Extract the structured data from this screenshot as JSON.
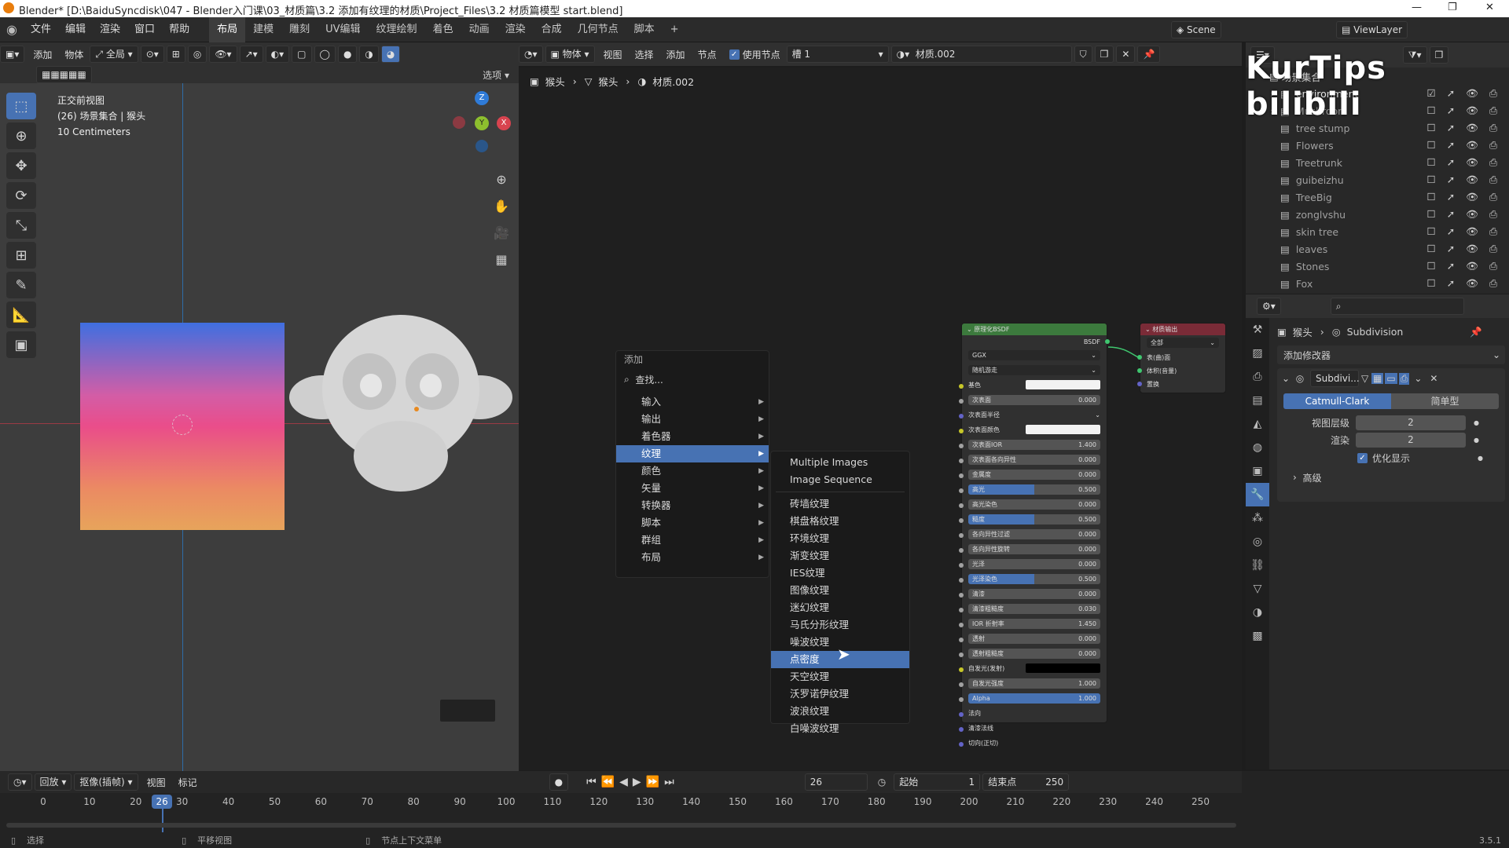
{
  "title_bar": {
    "text": "Blender* [D:\\BaiduSyncdisk\\047 - Blender入门课\\03_材质篇\\3.2 添加有纹理的材质\\Project_Files\\3.2 材质篇模型 start.blend]"
  },
  "menu": [
    "文件",
    "编辑",
    "渲染",
    "窗口",
    "帮助"
  ],
  "workspaces": [
    "布局",
    "建模",
    "雕刻",
    "UV编辑",
    "纹理绘制",
    "着色",
    "动画",
    "渲染",
    "合成",
    "几何节点",
    "脚本"
  ],
  "scene": {
    "scene_name": "Scene",
    "view_layer": "ViewLayer"
  },
  "viewport_header": {
    "add": "添加",
    "object": "物体",
    "transform": "全局",
    "options": "选项"
  },
  "viewport_overlay": {
    "view_name": "正交前视图",
    "collection": "(26) 场景集合 | 猴头",
    "scale": "10 Centimeters"
  },
  "gizmo": {
    "z": "Z",
    "y": "Y",
    "x": "X"
  },
  "node_header": {
    "mode": "物体",
    "view": "视图",
    "select": "选择",
    "add": "添加",
    "node": "节点",
    "use_nodes": "使用节点",
    "slot": "槽 1",
    "material": "材质.002"
  },
  "breadcrumb": [
    "猴头",
    "猴头",
    "材质.002"
  ],
  "add_menu": {
    "title": "添加",
    "search": "查找...",
    "items": [
      "输入",
      "输出",
      "着色器",
      "纹理",
      "颜色",
      "矢量",
      "转换器",
      "脚本",
      "群组",
      "布局"
    ],
    "selected": "纹理"
  },
  "texture_menu": {
    "top": [
      "Multiple Images",
      "Image Sequence"
    ],
    "items": [
      "砖墙纹理",
      "棋盘格纹理",
      "环境纹理",
      "渐变纹理",
      "IES纹理",
      "图像纹理",
      "迷幻纹理",
      "马氏分形纹理",
      "噪波纹理",
      "点密度",
      "天空纹理",
      "沃罗诺伊纹理",
      "波浪纹理",
      "白噪波纹理"
    ],
    "highlighted": "点密度"
  },
  "bsdf_node": {
    "title": "原理化BSDF",
    "output": "BSDF",
    "dist": "GGX",
    "sss": "随机游走",
    "rows": [
      {
        "label": "基色",
        "value": ""
      },
      {
        "label": "次表面",
        "value": "0.000"
      },
      {
        "label": "次表面半径",
        "value": ""
      },
      {
        "label": "次表面颜色",
        "value": ""
      },
      {
        "label": "次表面IOR",
        "value": "1.400"
      },
      {
        "label": "次表面各向异性",
        "value": "0.000"
      },
      {
        "label": "金属度",
        "value": "0.000"
      },
      {
        "label": "高光",
        "value": "0.500"
      },
      {
        "label": "高光染色",
        "value": "0.000"
      },
      {
        "label": "糙度",
        "value": "0.500"
      },
      {
        "label": "各向异性过滤",
        "value": "0.000"
      },
      {
        "label": "各向异性旋转",
        "value": "0.000"
      },
      {
        "label": "光泽",
        "value": "0.000"
      },
      {
        "label": "光泽染色",
        "value": "0.500"
      },
      {
        "label": "清漆",
        "value": "0.000"
      },
      {
        "label": "清漆粗糙度",
        "value": "0.030"
      },
      {
        "label": "IOR 折射率",
        "value": "1.450"
      },
      {
        "label": "透射",
        "value": "0.000"
      },
      {
        "label": "透射粗糙度",
        "value": "0.000"
      },
      {
        "label": "自发光(发射)",
        "value": ""
      },
      {
        "label": "自发光强度",
        "value": "1.000"
      },
      {
        "label": "Alpha",
        "value": "1.000"
      },
      {
        "label": "法向",
        "value": ""
      },
      {
        "label": "清漆法线",
        "value": ""
      },
      {
        "label": "切向(正切)",
        "value": ""
      }
    ]
  },
  "output_node": {
    "title": "材质输出",
    "target": "全部",
    "inputs": [
      "表(曲)面",
      "体积(音量)",
      "置换"
    ]
  },
  "outliner": {
    "root": "场景集合",
    "items": [
      "environment",
      "Mushroom",
      "tree stump",
      "Flowers",
      "Treetrunk",
      "guibeizhu",
      "TreeBig",
      "zonglvshu",
      "skin tree",
      "leaves",
      "Stones",
      "Fox"
    ]
  },
  "properties": {
    "search_placeholder": "",
    "breadcrumb_obj": "猴头",
    "breadcrumb_mod": "Subdivision",
    "add_modifier": "添加修改器",
    "modifier_name": "Subdivi...",
    "tab_catmull": "Catmull-Clark",
    "tab_simple": "简单型",
    "levels_label": "视图层级",
    "levels_value": "2",
    "render_label": "渲染",
    "render_value": "2",
    "optimal": "优化显示",
    "advanced": "高级"
  },
  "timeline": {
    "playback": "回放",
    "keying": "抠像(插帧)",
    "view": "视图",
    "marker": "标记",
    "current": "26",
    "start_label": "起始",
    "start": "1",
    "end_label": "结束点",
    "end": "250",
    "ticks": [
      "0",
      "10",
      "20",
      "30",
      "40",
      "50",
      "60",
      "70",
      "80",
      "90",
      "100",
      "110",
      "120",
      "130",
      "140",
      "150",
      "160",
      "170",
      "180",
      "190",
      "200",
      "210",
      "220",
      "230",
      "240",
      "250"
    ]
  },
  "status": {
    "select": "选择",
    "pan": "平移视图",
    "context": "节点上下文菜单",
    "version": "3.5.1"
  },
  "watermark": "KurTips bilibili"
}
